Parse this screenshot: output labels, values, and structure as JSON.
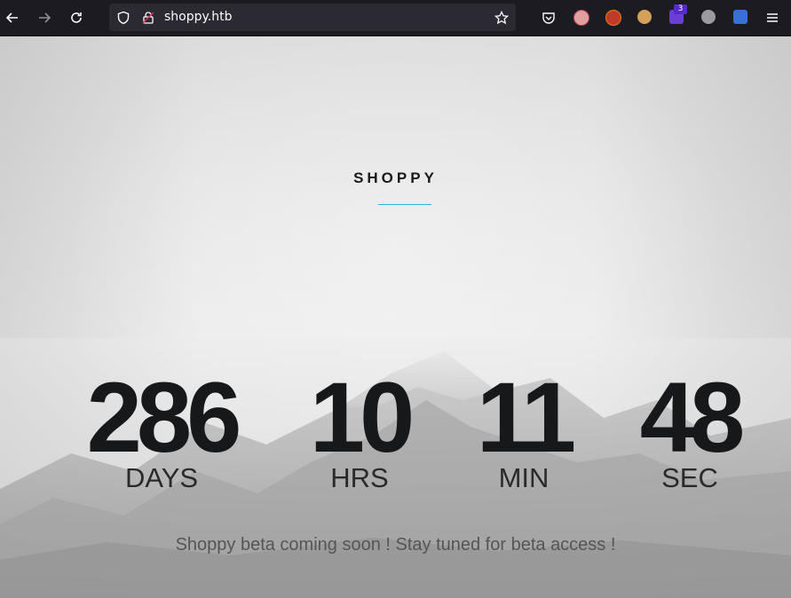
{
  "browser": {
    "url": "shoppy.htb",
    "extension_badge": "3",
    "icons": [
      "back-icon",
      "forward-icon",
      "reload-icon",
      "shield-icon",
      "lock-icon",
      "star-icon",
      "pocket-icon",
      "extension-icon",
      "menu-icon"
    ]
  },
  "page": {
    "brand": "SHOPPY",
    "countdown": [
      {
        "value": "286",
        "label": "DAYS"
      },
      {
        "value": "10",
        "label": "HRS"
      },
      {
        "value": "11",
        "label": "MIN"
      },
      {
        "value": "48",
        "label": "SEC"
      }
    ],
    "message": "Shoppy beta coming soon ! Stay tuned for beta access !"
  },
  "colors": {
    "chrome_bg": "#1c1b22",
    "urlbar_bg": "#2b2a33",
    "accent": "#26b6e0",
    "text_dark": "#16181a"
  }
}
